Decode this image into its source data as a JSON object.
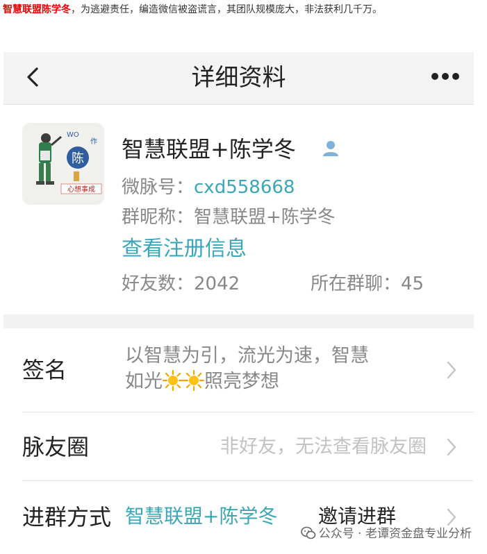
{
  "article": {
    "highlight": "智慧联盟陈学冬",
    "text": "，为逃避责任，编造微信被盗谎言，其团队规模庞大，非法获利几千万。"
  },
  "nav": {
    "back_icon": "chevron-left-icon",
    "title": "详细资料",
    "more_icon": "ellipsis-icon"
  },
  "profile": {
    "name": "智慧联盟+陈学冬",
    "id_label": "微脉号：",
    "id_value": "cxd558668",
    "group_nick_label": "群昵称：",
    "group_nick_value": "智慧联盟+陈学冬",
    "link": "查看注册信息",
    "friends_label": "好友数：",
    "friends_value": "2042",
    "groups_label": "所在群聊：",
    "groups_value": "45",
    "avatar_text": {
      "top": "WO",
      "badge": "陈",
      "side": "作",
      "bottom": "心想事成"
    }
  },
  "items": {
    "signature": {
      "label": "签名",
      "line1": "以智慧为引，流光为速，智慧",
      "line2_start": "如光",
      "line2_end": "照亮梦想"
    },
    "moments": {
      "label": "脉友圈",
      "value": "非好友，无法查看脉友圈"
    },
    "join": {
      "label": "进群方式",
      "value": "智慧联盟+陈学冬",
      "action": "邀请进群"
    }
  },
  "watermark": {
    "text": "公众号 · 老谭资金盘专业分析"
  },
  "colors": {
    "accent": "#3aa6b7",
    "highlight": "#e60000",
    "secondary_text": "#888888",
    "nav_bg": "#f3f3f3"
  }
}
